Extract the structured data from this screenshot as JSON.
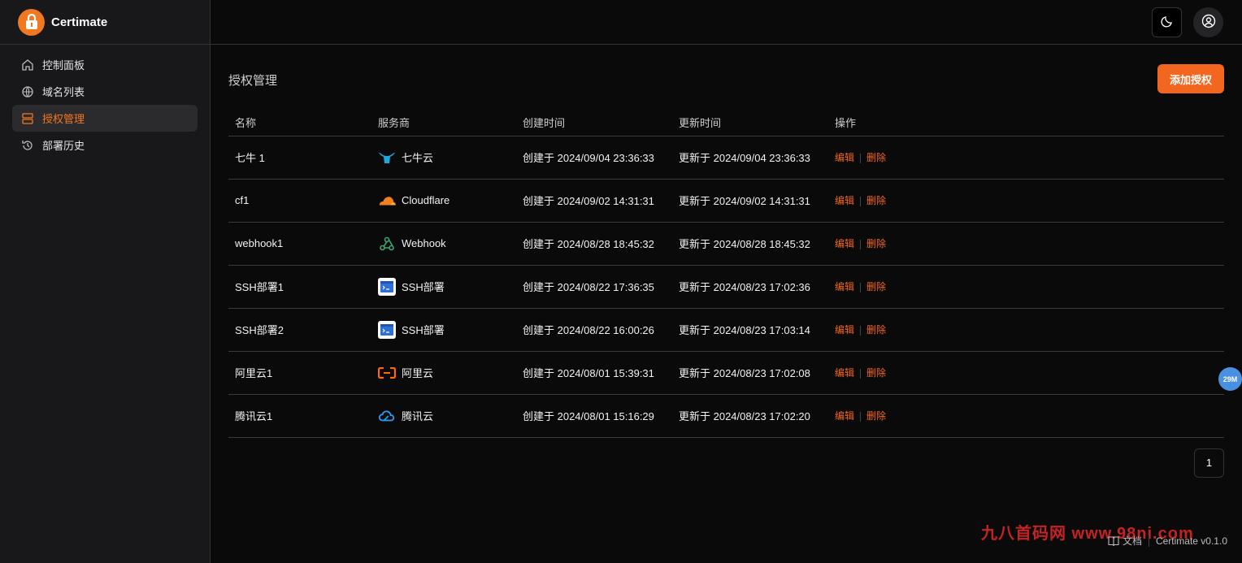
{
  "brand": {
    "name": "Certimate",
    "accent": "#f27721"
  },
  "sidebar": {
    "items": [
      {
        "label": "控制面板",
        "icon": "home-icon",
        "active": false
      },
      {
        "label": "域名列表",
        "icon": "globe-icon",
        "active": false
      },
      {
        "label": "授权管理",
        "icon": "server-icon",
        "active": true
      },
      {
        "label": "部署历史",
        "icon": "history-icon",
        "active": false
      }
    ]
  },
  "header": {
    "theme_icon": "moon-icon",
    "user_icon": "user-circle-icon"
  },
  "main": {
    "title": "授权管理",
    "add_button": "添加授权",
    "columns": [
      "名称",
      "服务商",
      "创建时间",
      "更新时间",
      "操作"
    ],
    "rows": [
      {
        "name": "七牛 1",
        "provider": "七牛云",
        "provider_icon": "qiniu-icon",
        "created": "创建于 2024/09/04 23:36:33",
        "updated": "更新于 2024/09/04 23:36:33"
      },
      {
        "name": "cf1",
        "provider": "Cloudflare",
        "provider_icon": "cloudflare-icon",
        "created": "创建于 2024/09/02 14:31:31",
        "updated": "更新于 2024/09/02 14:31:31"
      },
      {
        "name": "webhook1",
        "provider": "Webhook",
        "provider_icon": "webhook-icon",
        "created": "创建于 2024/08/28 18:45:32",
        "updated": "更新于 2024/08/28 18:45:32"
      },
      {
        "name": "SSH部署1",
        "provider": "SSH部署",
        "provider_icon": "ssh-icon",
        "created": "创建于 2024/08/22 17:36:35",
        "updated": "更新于 2024/08/23 17:02:36"
      },
      {
        "name": "SSH部署2",
        "provider": "SSH部署",
        "provider_icon": "ssh-icon",
        "created": "创建于 2024/08/22 16:00:26",
        "updated": "更新于 2024/08/23 17:03:14"
      },
      {
        "name": "阿里云1",
        "provider": "阿里云",
        "provider_icon": "aliyun-icon",
        "created": "创建于 2024/08/01 15:39:31",
        "updated": "更新于 2024/08/23 17:02:08"
      },
      {
        "name": "腾讯云1",
        "provider": "腾讯云",
        "provider_icon": "tencent-cloud-icon",
        "created": "创建于 2024/08/01 15:16:29",
        "updated": "更新于 2024/08/23 17:02:20"
      }
    ],
    "actions": {
      "edit": "编辑",
      "delete": "删除"
    },
    "pagination": {
      "current": "1"
    }
  },
  "float_badge": "29M",
  "footer": {
    "docs": "文档",
    "version": "Certimate v0.1.0"
  },
  "watermark": "九八首码网 www.98ni.com"
}
